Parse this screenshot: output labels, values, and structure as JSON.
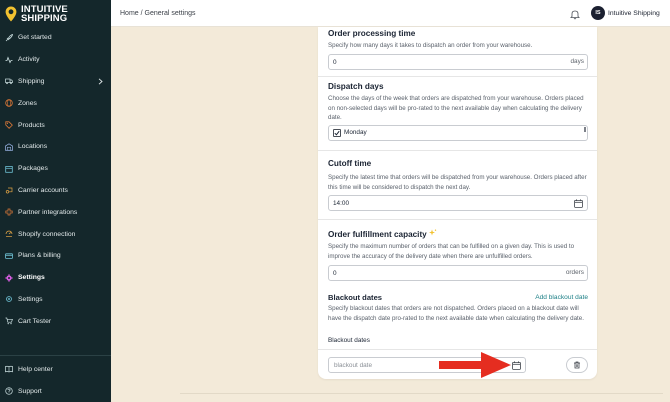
{
  "app": {
    "brand_line1": "INTUITIVE",
    "brand_line2": "SHIPPING"
  },
  "colors": {
    "sidebar_bg": "#14272b",
    "page_bg": "#f3ead9",
    "link": "#1c7f86",
    "accent_arrow": "#e52d20"
  },
  "sidebar": {
    "items": [
      {
        "label": "Get started",
        "icon": "rocket-icon"
      },
      {
        "label": "Activity",
        "icon": "activity-icon"
      },
      {
        "label": "Shipping",
        "icon": "truck-icon",
        "has_chevron": true
      },
      {
        "label": "Zones",
        "icon": "globe-icon"
      },
      {
        "label": "Products",
        "icon": "tag-icon"
      },
      {
        "label": "Locations",
        "icon": "warehouse-icon"
      },
      {
        "label": "Packages",
        "icon": "package-icon"
      },
      {
        "label": "Carrier accounts",
        "icon": "carrier-icon"
      },
      {
        "label": "Partner integrations",
        "icon": "integration-icon"
      },
      {
        "label": "Shopify connection",
        "icon": "shopify-icon"
      },
      {
        "label": "Plans & billing",
        "icon": "billing-icon"
      },
      {
        "label": "Settings",
        "icon": "gear-icon",
        "active": true
      },
      {
        "label": "Settings",
        "icon": "gear-outline-icon"
      },
      {
        "label": "Cart Tester",
        "icon": "cart-icon"
      }
    ],
    "bottom": [
      {
        "label": "Help center",
        "icon": "book-icon"
      },
      {
        "label": "Support",
        "icon": "help-icon"
      }
    ]
  },
  "header": {
    "breadcrumb": "Home / General settings",
    "avatar_initials": "IS",
    "user_name": "Intuitive Shipping"
  },
  "sections": {
    "processing": {
      "title": "Order processing time",
      "desc": "Specify how many days it takes to dispatch an order from your warehouse.",
      "value": "0",
      "suffix": "days"
    },
    "dispatch": {
      "title": "Dispatch days",
      "desc": "Choose the days of the week that orders are dispatched from your warehouse. Orders placed on non-selected days will be pro-rated to the next available day when calculating the delivery date.",
      "option": "Monday",
      "checked": true
    },
    "cutoff": {
      "title": "Cutoff time",
      "desc": "Specify the latest time that orders will be dispatched from your warehouse. Orders placed after this time will be considered to dispatch the next day.",
      "value": "14:00"
    },
    "capacity": {
      "title": "Order fulfillment capacity",
      "desc": "Specify the maximum number of orders that can be fulfilled on a given day. This is used to improve the accuracy of the delivery date when there are unfulfilled orders.",
      "value": "0",
      "suffix": "orders"
    },
    "blackout": {
      "title": "Blackout dates",
      "add_link": "Add blackout date",
      "desc": "Specify blackout dates that orders are not dispatched. Orders placed on a blackout date will have the dispatch date pro-rated to the next available date when calculating the delivery date.",
      "list_label": "Blackout dates",
      "placeholder": "blackout date"
    }
  }
}
